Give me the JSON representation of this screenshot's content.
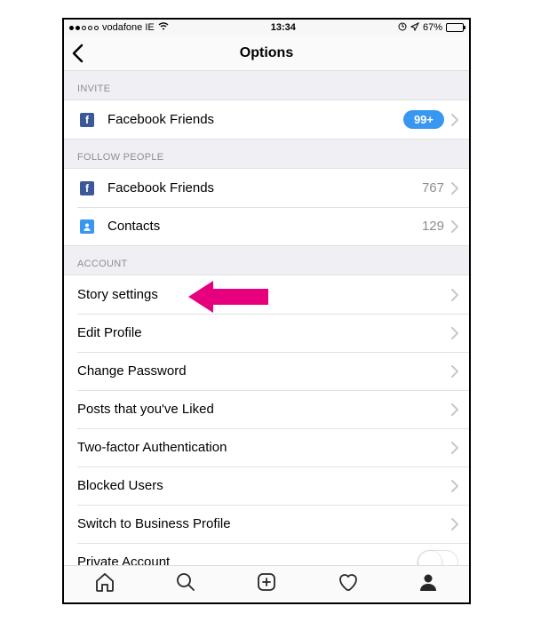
{
  "status": {
    "carrier": "vodafone IE",
    "time": "13:34",
    "battery_pct": "67%"
  },
  "nav": {
    "title": "Options"
  },
  "sections": {
    "invite": {
      "header": "INVITE",
      "fb_friends_label": "Facebook Friends",
      "fb_friends_badge": "99+"
    },
    "follow": {
      "header": "FOLLOW PEOPLE",
      "fb_friends_label": "Facebook Friends",
      "fb_friends_count": "767",
      "contacts_label": "Contacts",
      "contacts_count": "129"
    },
    "account": {
      "header": "ACCOUNT",
      "items": [
        "Story settings",
        "Edit Profile",
        "Change Password",
        "Posts that you've Liked",
        "Two-factor Authentication",
        "Blocked Users",
        "Switch to Business Profile",
        "Private Account"
      ]
    }
  }
}
